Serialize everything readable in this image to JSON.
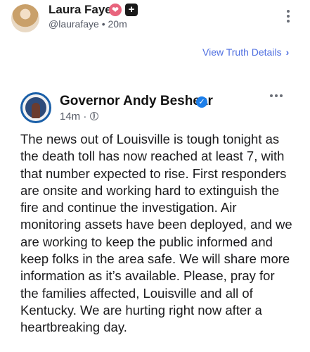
{
  "truth": {
    "author_name": "Laura Faye",
    "handle": "@laurafaye",
    "time": "20m",
    "separator": "•",
    "verified_badge_icon": "heart-verified-icon",
    "plus_badge_icon": "plus-square-icon",
    "view_details_label": "View Truth Details",
    "view_details_icon": "chevron-right-icon",
    "more_icon": "more-vertical-icon"
  },
  "embedded_post": {
    "author_name": "Governor Andy Beshear",
    "time": "14m",
    "separator": "·",
    "privacy_icon": "globe-icon",
    "verified_icon": "blue-check-icon",
    "more_icon": "more-horizontal-icon",
    "body": "The news out of Louisville is tough tonight as the death toll has now reached at least 7, with that number expected to rise. First responders are onsite and working hard to extinguish the fire and continue the investigation. Air monitoring assets have been deployed, and we are working to keep the public informed and keep folks in the area safe. We will share more information as it’s available. Please, pray for the families affected, Louisville and all of Kentucky. We are hurting right now after a heartbreaking day."
  },
  "colors": {
    "link": "#4f6fe0",
    "verified_blue": "#1d7fea",
    "badge_pink": "#e8647d"
  }
}
